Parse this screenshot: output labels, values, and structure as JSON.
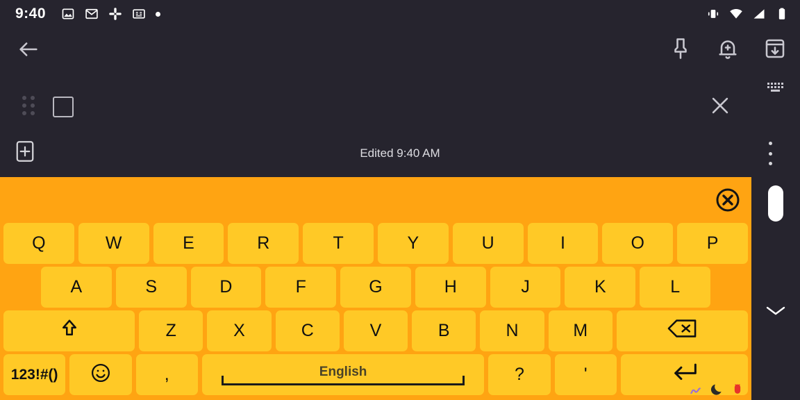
{
  "status_bar": {
    "clock": "9:40",
    "left_icons": [
      "photos-icon",
      "gmail-icon",
      "slack-icon",
      "google-news-icon",
      "dot-icon"
    ],
    "right_icons": [
      "vibrate-icon",
      "wifi-icon",
      "cell-signal-icon",
      "battery-icon"
    ]
  },
  "app_bar": {
    "back_icon": "back-arrow-icon",
    "actions": [
      "pin-icon",
      "reminder-bell-icon",
      "archive-icon"
    ]
  },
  "checklist_row": {
    "drag_handle_icon": "drag-handle-icon",
    "checkbox_icon": "checkbox-unchecked-icon",
    "checked": false,
    "close_icon": "close-icon",
    "keyboard_mini_icon": "keyboard-icon"
  },
  "edited_bar": {
    "add_icon": "add-box-icon",
    "edited_text": "Edited 9:40 AM",
    "overflow_icon": "more-vertical-icon"
  },
  "keyboard": {
    "close_icon": "close-circle-icon",
    "background_color": "#ffa412",
    "key_color": "#ffc926",
    "key_text_color": "#101010",
    "rows": [
      {
        "name": "row-1",
        "keys": [
          {
            "label": "Q",
            "name": "key-q"
          },
          {
            "label": "W",
            "name": "key-w"
          },
          {
            "label": "E",
            "name": "key-e"
          },
          {
            "label": "R",
            "name": "key-r"
          },
          {
            "label": "T",
            "name": "key-t"
          },
          {
            "label": "Y",
            "name": "key-y"
          },
          {
            "label": "U",
            "name": "key-u"
          },
          {
            "label": "I",
            "name": "key-i"
          },
          {
            "label": "O",
            "name": "key-o"
          },
          {
            "label": "P",
            "name": "key-p"
          }
        ]
      },
      {
        "name": "row-2",
        "keys": [
          {
            "label": "A",
            "name": "key-a"
          },
          {
            "label": "S",
            "name": "key-s"
          },
          {
            "label": "D",
            "name": "key-d"
          },
          {
            "label": "F",
            "name": "key-f"
          },
          {
            "label": "G",
            "name": "key-g"
          },
          {
            "label": "H",
            "name": "key-h"
          },
          {
            "label": "J",
            "name": "key-j"
          },
          {
            "label": "K",
            "name": "key-k"
          },
          {
            "label": "L",
            "name": "key-l"
          }
        ]
      },
      {
        "name": "row-3",
        "keys": [
          {
            "label": "",
            "name": "key-shift",
            "icon": "shift-arrow-icon"
          },
          {
            "label": "Z",
            "name": "key-z"
          },
          {
            "label": "X",
            "name": "key-x"
          },
          {
            "label": "C",
            "name": "key-c"
          },
          {
            "label": "V",
            "name": "key-v"
          },
          {
            "label": "B",
            "name": "key-b"
          },
          {
            "label": "N",
            "name": "key-n"
          },
          {
            "label": "M",
            "name": "key-m"
          },
          {
            "label": "",
            "name": "key-backspace",
            "icon": "backspace-icon"
          }
        ]
      },
      {
        "name": "row-4",
        "keys": [
          {
            "label": "123!#()",
            "name": "key-symbols"
          },
          {
            "label": "",
            "name": "key-emoji",
            "icon": "smiley-icon"
          },
          {
            "label": ",",
            "name": "key-comma"
          },
          {
            "label": "English",
            "name": "key-space"
          },
          {
            "label": "?",
            "name": "key-question"
          },
          {
            "label": "'",
            "name": "key-apostrophe"
          },
          {
            "label": "",
            "name": "key-enter",
            "icon": "enter-icon"
          }
        ]
      }
    ],
    "space_label": "English",
    "footer_icons": [
      "worm-icon",
      "moon-icon",
      "bug-icon"
    ]
  },
  "right_rail": {
    "scrollbar_thumb": "scrollbar-thumb",
    "collapse_icon": "chevron-down-icon"
  }
}
